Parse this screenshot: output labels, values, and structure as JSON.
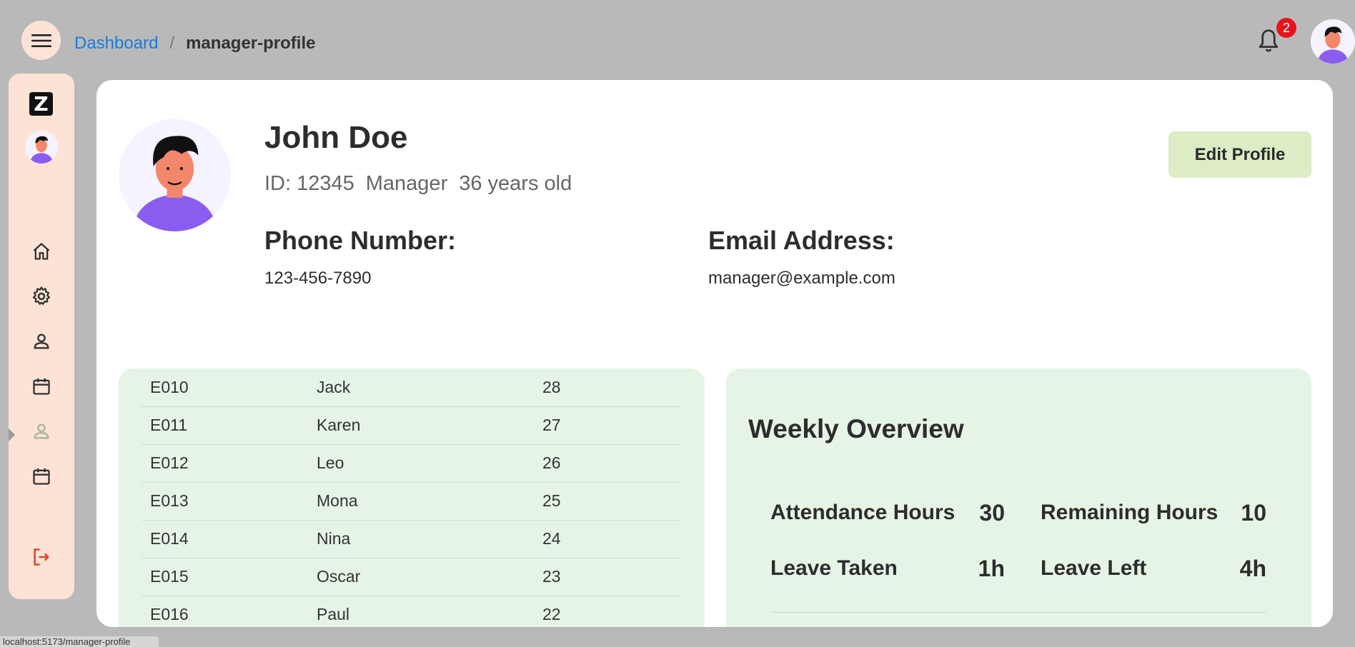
{
  "header": {
    "breadcrumb": {
      "link": "Dashboard",
      "separator": "/",
      "current": "manager-profile"
    },
    "notification_count": "2"
  },
  "sidebar": {
    "logo": "Z",
    "items": [
      {
        "icon": "home-icon"
      },
      {
        "icon": "gear-icon"
      },
      {
        "icon": "person-icon"
      },
      {
        "icon": "calendar-icon"
      },
      {
        "icon": "person-icon",
        "active": true
      },
      {
        "icon": "calendar-icon"
      },
      {
        "icon": "logout-icon"
      }
    ]
  },
  "profile": {
    "name": "John Doe",
    "id": "ID: 12345",
    "role": "Manager",
    "age": "36 years old",
    "edit_label": "Edit Profile",
    "phone_label": "Phone Number:",
    "phone": "123-456-7890",
    "email_label": "Email Address:",
    "email": "manager@example.com"
  },
  "employees": [
    {
      "id": "E010",
      "name": "Jack",
      "age": "28"
    },
    {
      "id": "E011",
      "name": "Karen",
      "age": "27"
    },
    {
      "id": "E012",
      "name": "Leo",
      "age": "26"
    },
    {
      "id": "E013",
      "name": "Mona",
      "age": "25"
    },
    {
      "id": "E014",
      "name": "Nina",
      "age": "24"
    },
    {
      "id": "E015",
      "name": "Oscar",
      "age": "23"
    },
    {
      "id": "E016",
      "name": "Paul",
      "age": "22"
    }
  ],
  "overview": {
    "title": "Weekly Overview",
    "attendance_label": "Attendance Hours",
    "attendance_value": "30",
    "remaining_label": "Remaining Hours",
    "remaining_value": "10",
    "leave_taken_label": "Leave Taken",
    "leave_taken_value": "1h",
    "leave_left_label": "Leave Left",
    "leave_left_value": "4h"
  },
  "status_bar": "localhost:5173/manager-profile",
  "colors": {
    "background": "#b9b9b9",
    "sidebar": "#fde3d6",
    "panel": "#e6f4e6",
    "edit_button": "#dcecc5",
    "link": "#1a7bd6",
    "badge": "#e8141c",
    "logout": "#e0452c"
  }
}
